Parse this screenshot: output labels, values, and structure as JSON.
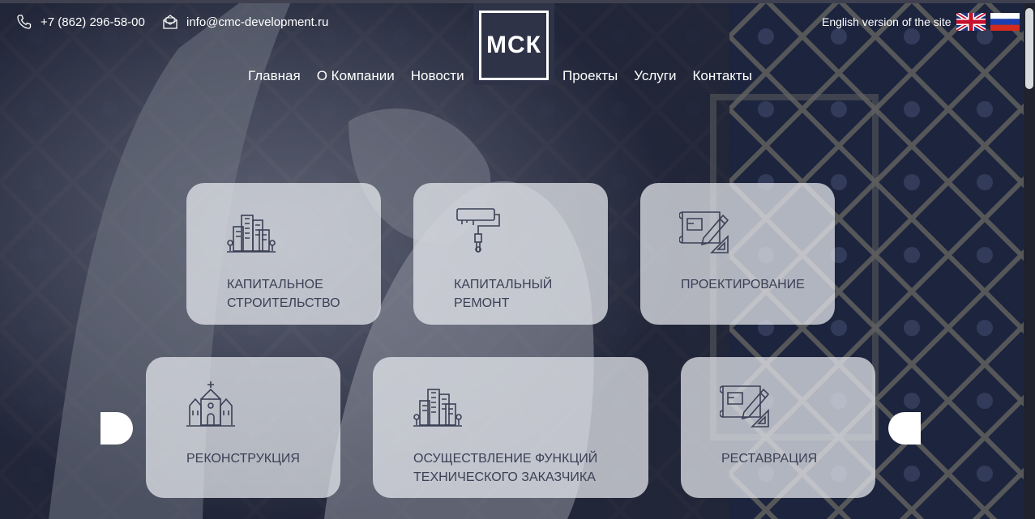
{
  "header": {
    "phone": "+7 (862) 296-58-00",
    "email": "info@cmc-development.ru",
    "logo_text": "МСК",
    "lang_text": "English version of the site",
    "nav_left": [
      "Главная",
      "О Компании",
      "Новости"
    ],
    "nav_right": [
      "Проекты",
      "Услуги",
      "Контакты"
    ]
  },
  "services": [
    {
      "line1": "Капитальное",
      "line2": "строительство",
      "icon": "city-buildings-icon"
    },
    {
      "line1": "Капитальный",
      "line2": "ремонт",
      "icon": "paint-roller-icon"
    },
    {
      "line1": "Проектирование",
      "line2": "",
      "icon": "blueprint-pencil-icon"
    },
    {
      "line1": "Реконструкция",
      "line2": "",
      "icon": "church-icon"
    },
    {
      "line1": "Осуществление функций",
      "line2": "технического заказчика",
      "icon": "city-buildings-icon"
    },
    {
      "line1": "Реставрация",
      "line2": "",
      "icon": "blueprint-pencil-icon"
    }
  ],
  "colors": {
    "card_text": "#3b4056",
    "logo_bg": "#2e3348",
    "card_bg": "rgba(230,232,238,0.74)"
  }
}
